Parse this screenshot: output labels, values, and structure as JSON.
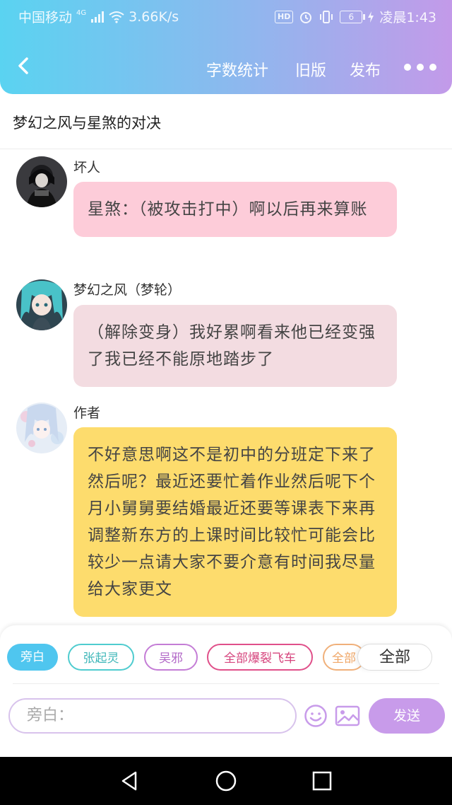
{
  "status_bar": {
    "carrier": "中国移动",
    "network": "4G",
    "speed": "3.66K/s",
    "hd": "HD",
    "battery": "6",
    "time": "凌晨1:43"
  },
  "navbar": {
    "word_count": "字数统计",
    "old_version": "旧版",
    "publish": "发布"
  },
  "story_title": "梦幻之风与星煞的对决",
  "messages": [
    {
      "speaker": "坏人",
      "text": "星煞：（被攻击打中）啊以后再来算账",
      "bubble_color": "#fdccd9"
    },
    {
      "speaker": "梦幻之风（梦轮）",
      "text": "（解除变身）我好累啊看来他已经变强了我已经不能原地踏步了",
      "bubble_color": "#f3dce1"
    },
    {
      "speaker": "作者",
      "text": "不好意思啊这不是初中的分班定下来了然后呢？最近还要忙着作业然后呢下个月小舅舅要结婚最近还要等课表下来再调整新东方的上课时间比较忙可能会比较少一点请大家不要介意有时间我尽量给大家更文",
      "bubble_color": "#fddc6d"
    }
  ],
  "role_chips": {
    "narrator": "旁白",
    "zhang_qiling": "张起灵",
    "wu_xie": "吴邪",
    "all_burst": "全部爆裂飞车",
    "partial": "全部",
    "all": "全部"
  },
  "input": {
    "placeholder": "旁白："
  },
  "send_label": "发送"
}
